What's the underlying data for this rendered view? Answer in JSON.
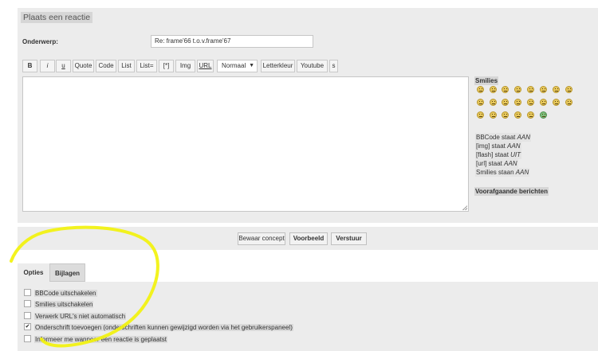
{
  "panel": {
    "title": "Plaats een reactie",
    "subject_label": "Onderwerp:",
    "subject_value": "Re: frame'66 t.o.v.frame'67"
  },
  "toolbar": {
    "bold": "B",
    "italic": "i",
    "underline": "u",
    "quote": "Quote",
    "code": "Code",
    "list": "List",
    "list_eq": "List=",
    "list_item": "[*]",
    "img": "Img",
    "url": "URL",
    "font_size": "Normaal",
    "font_color": "Letterkleur",
    "youtube": "Youtube",
    "s": "s"
  },
  "sidebar": {
    "smilies_title": "Smilies",
    "status": [
      {
        "prefix": "BBCode staat ",
        "value": "AAN"
      },
      {
        "prefix": "[img] staat ",
        "value": "AAN"
      },
      {
        "prefix": "[flash] staat ",
        "value": "UIT"
      },
      {
        "prefix": "[url] staat ",
        "value": "AAN"
      },
      {
        "prefix": "Smilies staan ",
        "value": "AAN"
      }
    ],
    "previous_messages": "Voorafgaande berichten"
  },
  "actions": {
    "save_draft": "Bewaar concept",
    "preview": "Voorbeeld",
    "submit": "Verstuur"
  },
  "tabs": {
    "options": "Opties",
    "attachments": "Bijlagen"
  },
  "options": [
    {
      "label": "BBCode uitschakelen",
      "checked": false
    },
    {
      "label": "Smilies uitschakelen",
      "checked": false
    },
    {
      "label": "Verwerk URL's niet automatisch",
      "checked": false
    },
    {
      "label": "Onderschrift toevoegen (onderschriften kunnen gewijzigd worden via het gebruikerspaneel)",
      "checked": true
    },
    {
      "label": "Informeer me wanneer een reactie is geplaatst",
      "checked": false
    }
  ],
  "colors": {
    "panel_bg": "#ececec",
    "highlight": "#f2f20c"
  },
  "icons": {
    "select_arrow": "chevron-down-icon",
    "smiley": "smiley-icon",
    "checkmark": "check-icon"
  }
}
